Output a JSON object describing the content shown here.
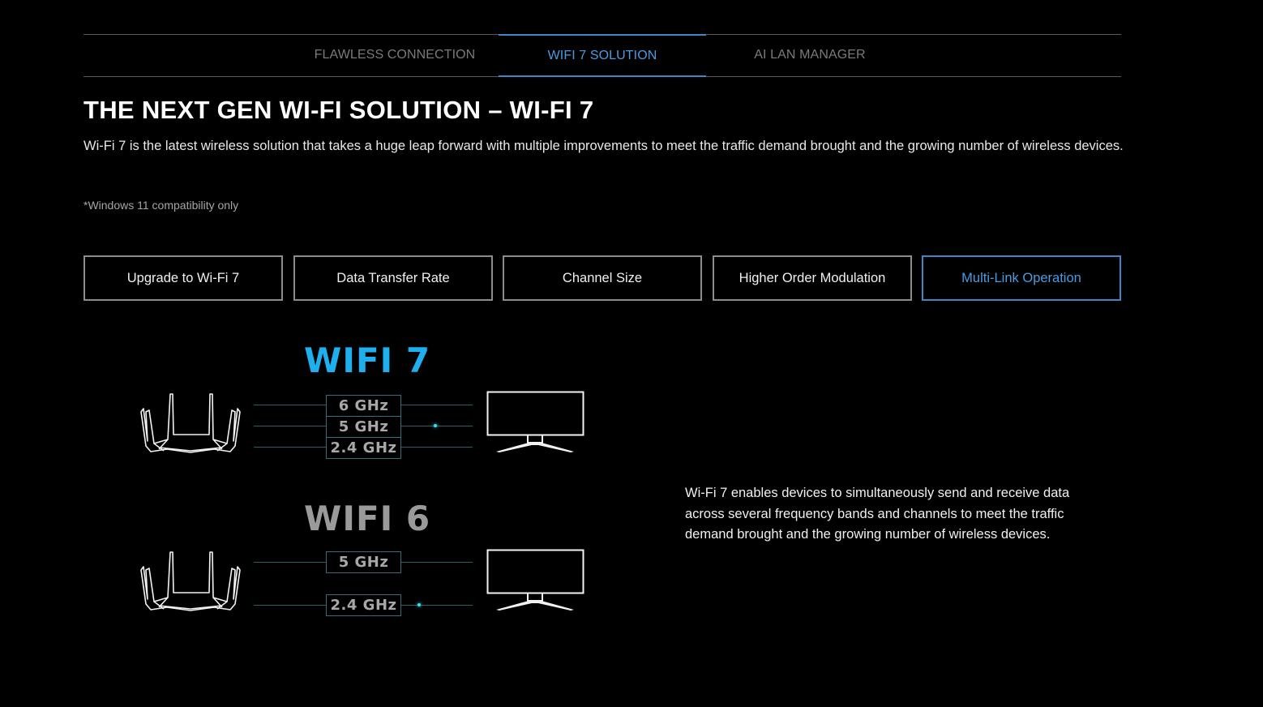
{
  "tabs": [
    {
      "label": "FLAWLESS CONNECTION",
      "active": false
    },
    {
      "label": "WIFI 7 SOLUTION",
      "active": true
    },
    {
      "label": "AI LAN MANAGER",
      "active": false
    }
  ],
  "header": {
    "title": "THE NEXT GEN WI-FI SOLUTION – WI-FI 7",
    "description": "Wi-Fi 7 is the latest wireless solution that takes a huge leap forward with multiple improvements to meet the traffic demand brought and the growing number of wireless devices.",
    "note": "*Windows 11 compatibility only"
  },
  "subtabs": [
    {
      "label": "Upgrade to Wi-Fi 7",
      "active": false
    },
    {
      "label": "Data Transfer Rate",
      "active": false
    },
    {
      "label": "Channel Size",
      "active": false
    },
    {
      "label": "Higher Order Modulation",
      "active": false
    },
    {
      "label": "Multi-Link Operation",
      "active": true
    }
  ],
  "diagram": {
    "wifi7": {
      "title": "WIFI 7",
      "bands": [
        "6 GHz",
        "5 GHz",
        "2.4 GHz"
      ],
      "router_icon": "router-icon",
      "device_icon": "monitor-icon"
    },
    "wifi6": {
      "title": "WIFI 6",
      "bands": [
        "5 GHz",
        "2.4 GHz"
      ],
      "router_icon": "router-icon",
      "device_icon": "monitor-icon"
    }
  },
  "info_text": "Wi-Fi 7 enables devices to simultaneously send and receive data across several frequency bands and channels to meet the traffic demand brought and the growing number of wireless devices.",
  "colors": {
    "accent": "#4a9be0",
    "wifi7": "#1eb0ee",
    "wifi6": "#9a9a9a",
    "signal_dot": "#3ee0f0"
  }
}
